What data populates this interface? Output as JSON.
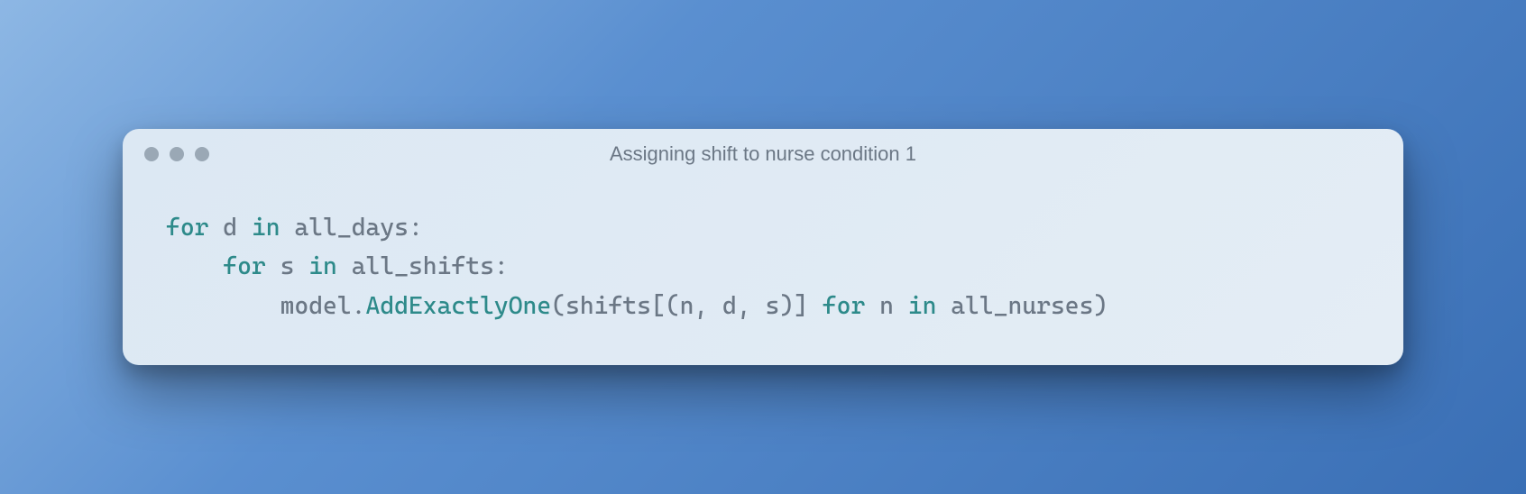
{
  "window": {
    "title": "Assigning shift to nurse condition 1"
  },
  "code": {
    "tokens": [
      [
        {
          "t": "for",
          "c": "kw"
        },
        {
          "t": " ",
          "c": "ident"
        },
        {
          "t": "d",
          "c": "ident"
        },
        {
          "t": " ",
          "c": "ident"
        },
        {
          "t": "in",
          "c": "kw"
        },
        {
          "t": " ",
          "c": "ident"
        },
        {
          "t": "all_days",
          "c": "ident"
        },
        {
          "t": ":",
          "c": "punct"
        }
      ],
      [
        {
          "t": "    ",
          "c": "ident"
        },
        {
          "t": "for",
          "c": "kw"
        },
        {
          "t": " ",
          "c": "ident"
        },
        {
          "t": "s",
          "c": "ident"
        },
        {
          "t": " ",
          "c": "ident"
        },
        {
          "t": "in",
          "c": "kw"
        },
        {
          "t": " ",
          "c": "ident"
        },
        {
          "t": "all_shifts",
          "c": "ident"
        },
        {
          "t": ":",
          "c": "punct"
        }
      ],
      [
        {
          "t": "        ",
          "c": "ident"
        },
        {
          "t": "model",
          "c": "ident"
        },
        {
          "t": ".",
          "c": "punct"
        },
        {
          "t": "AddExactlyOne",
          "c": "func"
        },
        {
          "t": "(",
          "c": "punct"
        },
        {
          "t": "shifts",
          "c": "ident"
        },
        {
          "t": "[(",
          "c": "punct"
        },
        {
          "t": "n",
          "c": "ident"
        },
        {
          "t": ", ",
          "c": "punct"
        },
        {
          "t": "d",
          "c": "ident"
        },
        {
          "t": ", ",
          "c": "punct"
        },
        {
          "t": "s",
          "c": "ident"
        },
        {
          "t": ")]",
          "c": "punct"
        },
        {
          "t": " ",
          "c": "ident"
        },
        {
          "t": "for",
          "c": "kw"
        },
        {
          "t": " ",
          "c": "ident"
        },
        {
          "t": "n",
          "c": "ident"
        },
        {
          "t": " ",
          "c": "ident"
        },
        {
          "t": "in",
          "c": "kw"
        },
        {
          "t": " ",
          "c": "ident"
        },
        {
          "t": "all_nurses",
          "c": "ident"
        },
        {
          "t": ")",
          "c": "punct"
        }
      ]
    ]
  }
}
